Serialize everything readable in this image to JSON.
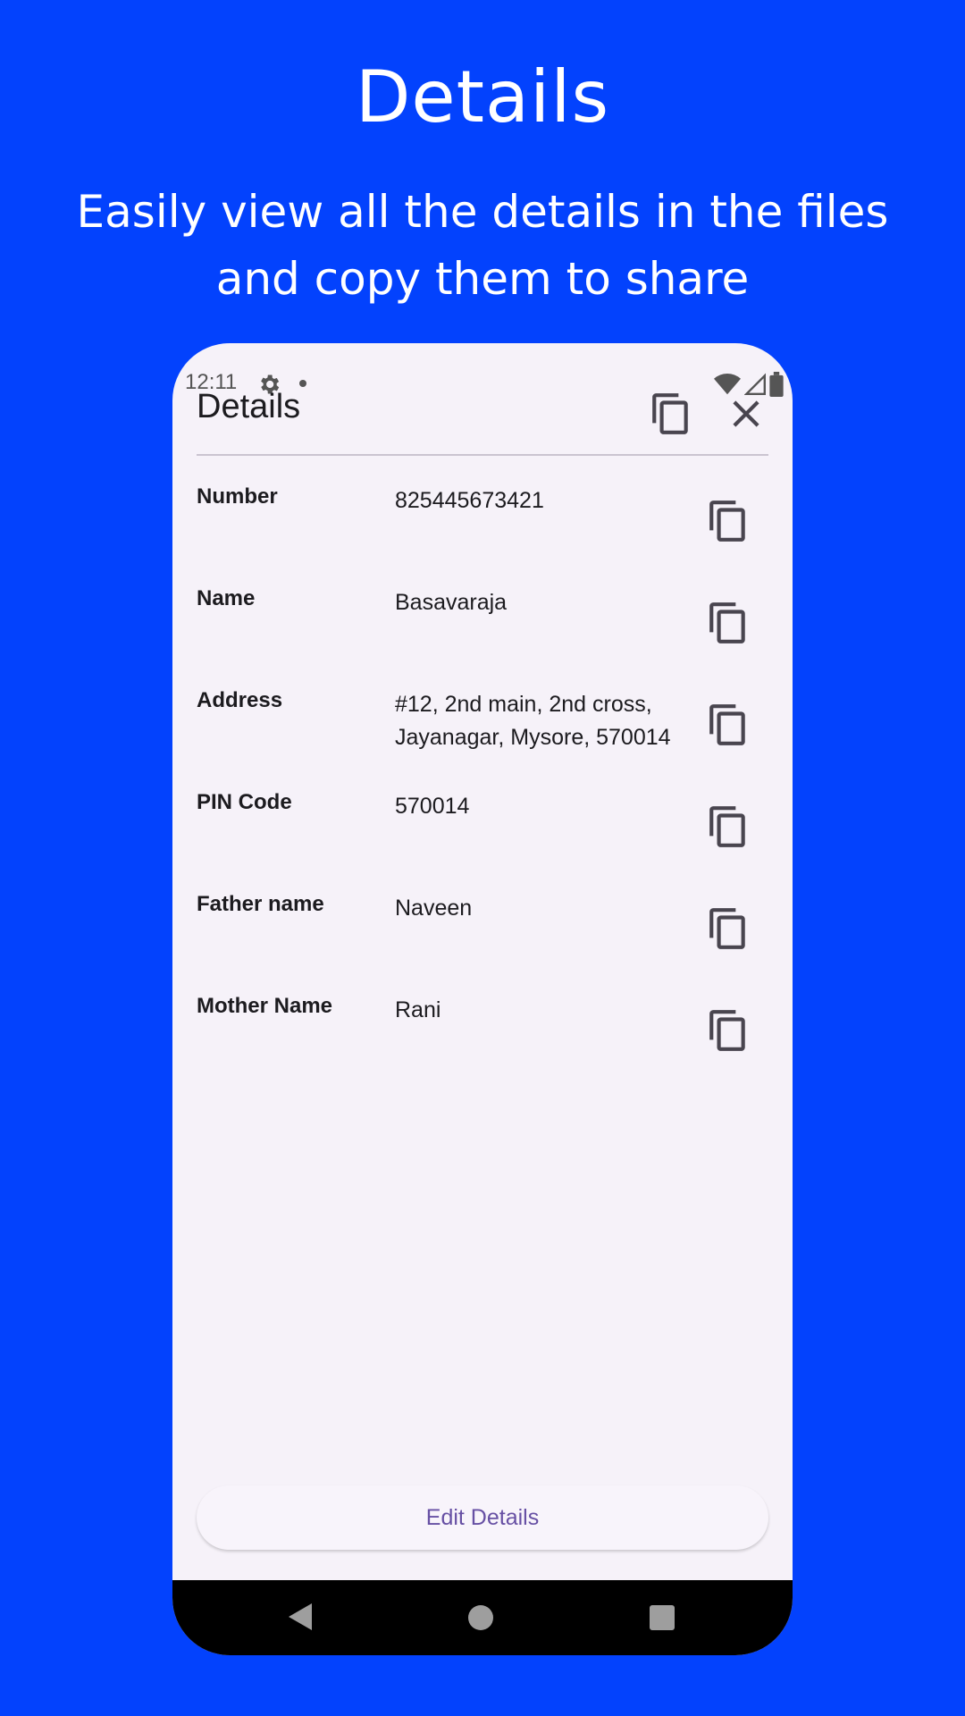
{
  "hero": {
    "title": "Details",
    "subtitle": "Easily view all the details in the files and copy them to share"
  },
  "statusbar": {
    "time": "12:11",
    "icons": [
      "gear-icon",
      "dot-icon",
      "wifi-icon",
      "signal-icon",
      "battery-icon"
    ]
  },
  "header": {
    "title": "Details",
    "icons": [
      "copy-icon",
      "close-icon"
    ]
  },
  "fields": [
    {
      "label": "Number",
      "value": "825445673421"
    },
    {
      "label": "Name",
      "value": "Basavaraja"
    },
    {
      "label": "Address",
      "value": "#12, 2nd main, 2nd cross, Jayanagar, Mysore, 570014"
    },
    {
      "label": "PIN Code",
      "value": "570014"
    },
    {
      "label": "Father name",
      "value": "Naveen"
    },
    {
      "label": "Mother Name",
      "value": "Rani"
    }
  ],
  "actions": {
    "edit_label": "Edit Details"
  },
  "navbar": {
    "icons": [
      "back-icon",
      "home-icon",
      "recents-icon"
    ]
  },
  "colors": {
    "background": "#0342fd",
    "screen": "#f6f2f9",
    "accent": "#6750a4"
  }
}
